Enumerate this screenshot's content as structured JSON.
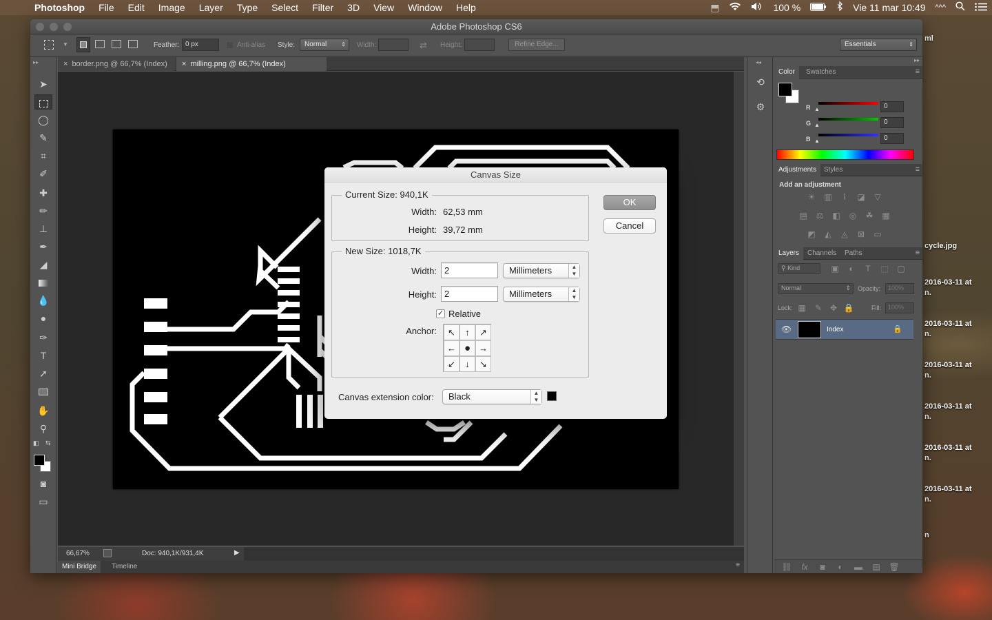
{
  "menubar": {
    "app": "Photoshop",
    "items": [
      "File",
      "Edit",
      "Image",
      "Layer",
      "Type",
      "Select",
      "Filter",
      "3D",
      "View",
      "Window",
      "Help"
    ],
    "battery": "100 %",
    "datetime": "Vie 11 mar  10:49"
  },
  "window": {
    "title": "Adobe Photoshop CS6"
  },
  "options": {
    "feather_label": "Feather:",
    "feather_value": "0 px",
    "antialias_label": "Anti-alias",
    "style_label": "Style:",
    "style_value": "Normal",
    "width_label": "Width:",
    "height_label": "Height:",
    "refine_edge": "Refine Edge...",
    "workspace": "Essentials"
  },
  "tabs": [
    {
      "label": "border.png @ 66,7% (Index)"
    },
    {
      "label": "milling.png @ 66,7% (Index)"
    }
  ],
  "status": {
    "zoom": "66,67%",
    "doc": "Doc: 940,1K/931,4K"
  },
  "bottom_tabs": [
    "Mini Bridge",
    "Timeline"
  ],
  "panels": {
    "color_tabs": [
      "Color",
      "Swatches"
    ],
    "rgb": [
      {
        "label": "R",
        "value": "0"
      },
      {
        "label": "G",
        "value": "0"
      },
      {
        "label": "B",
        "value": "0"
      }
    ],
    "adjust_tabs": [
      "Adjustments",
      "Styles"
    ],
    "add_adjustment": "Add an adjustment",
    "layers_tabs": [
      "Layers",
      "Channels",
      "Paths"
    ],
    "kind": "Kind",
    "blend": "Normal",
    "opacity_label": "Opacity:",
    "opacity_value": "100%",
    "lock_label": "Lock:",
    "fill_label": "Fill:",
    "fill_value": "100%",
    "layer_name": "Index"
  },
  "dialog": {
    "title": "Canvas Size",
    "current_size": "Current Size: 940,1K",
    "cur_width_label": "Width:",
    "cur_width": "62,53 mm",
    "cur_height_label": "Height:",
    "cur_height": "39,72 mm",
    "new_size": "New Size: 1018,7K",
    "width_label": "Width:",
    "width_value": "2",
    "width_unit": "Millimeters",
    "height_label": "Height:",
    "height_value": "2",
    "height_unit": "Millimeters",
    "relative": "Relative",
    "anchor_label": "Anchor:",
    "ext_label": "Canvas extension color:",
    "ext_value": "Black",
    "ok": "OK",
    "cancel": "Cancel"
  },
  "desktop": {
    "items": [
      "ml",
      "cycle.jpg",
      "2016-03-11 at",
      "n.",
      "2016-03-11 at",
      "n.",
      "2016-03-11 at",
      "n.",
      "2016-03-11 at",
      "n.",
      "2016-03-11 at",
      "n.",
      "2016-03-11 at",
      "n.",
      "n"
    ]
  }
}
